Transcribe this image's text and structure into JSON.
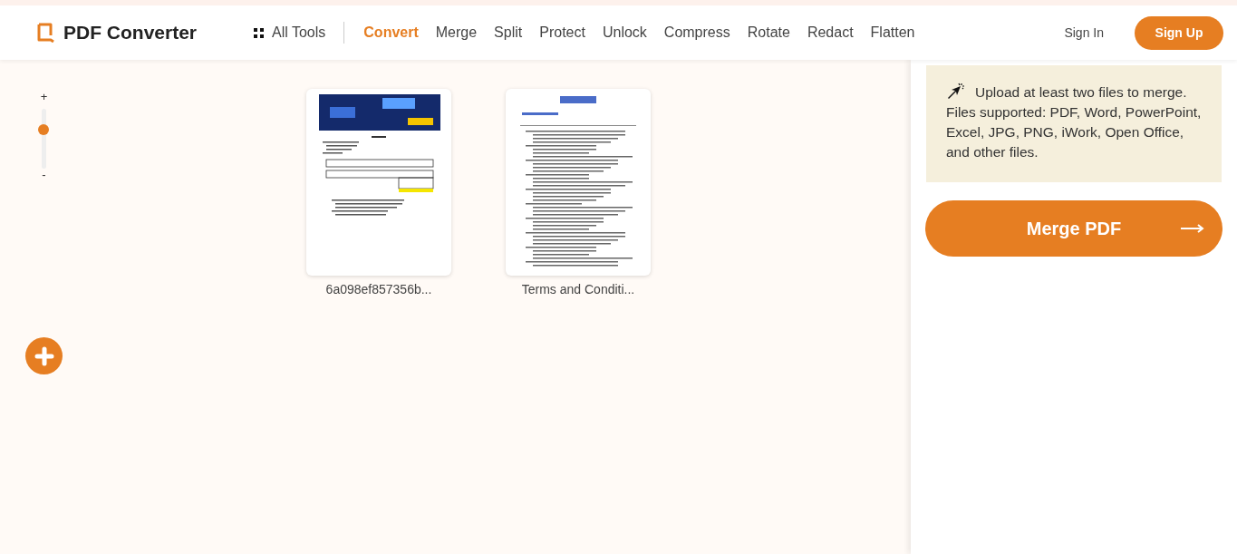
{
  "header": {
    "logo": "PDF Converter",
    "all_tools": "All Tools",
    "nav": [
      {
        "label": "Convert",
        "selected": true
      },
      {
        "label": "Merge",
        "selected": false
      },
      {
        "label": "Split",
        "selected": false
      },
      {
        "label": "Protect",
        "selected": false
      },
      {
        "label": "Unlock",
        "selected": false
      },
      {
        "label": "Compress",
        "selected": false
      },
      {
        "label": "Rotate",
        "selected": false
      },
      {
        "label": "Redact",
        "selected": false
      },
      {
        "label": "Flatten",
        "selected": false
      }
    ],
    "sign_in": "Sign In",
    "sign_up": "Sign Up"
  },
  "zoom": {
    "plus": "+",
    "minus": "-",
    "level": 0.65
  },
  "files": [
    {
      "name": "6a098ef857356b...",
      "kind": "receipt"
    },
    {
      "name": "Terms and Conditi...",
      "kind": "text"
    }
  ],
  "panel": {
    "hint": "Upload at least two files to merge. Files supported: PDF, Word, PowerPoint, Excel, JPG, PNG, iWork, Open Office, and other files.",
    "button": "Merge PDF"
  }
}
